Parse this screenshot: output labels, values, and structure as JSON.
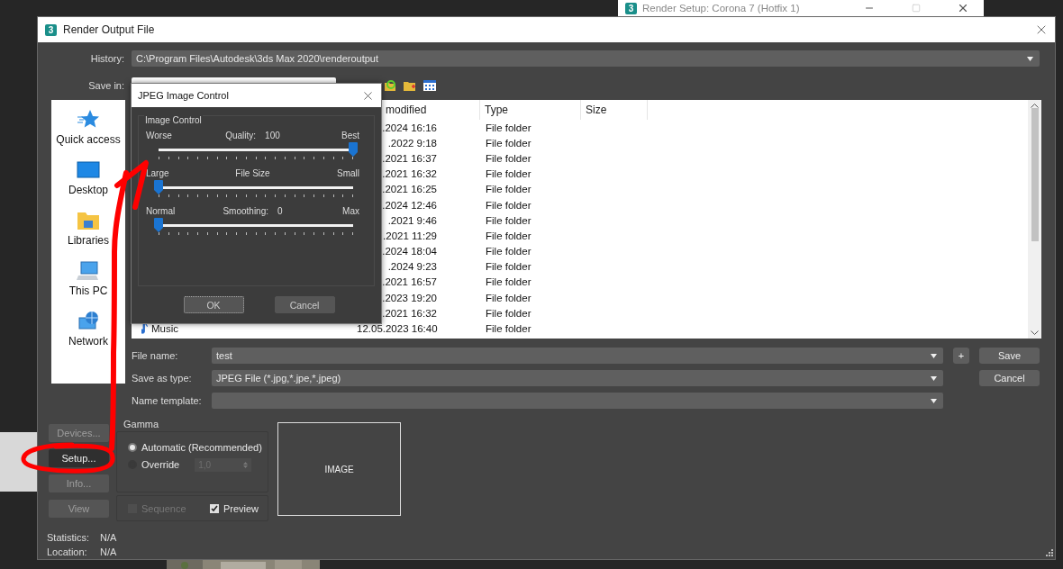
{
  "background_window": {
    "icon_text": "3",
    "title": "Render Setup: Corona 7 (Hotfix 1)"
  },
  "window": {
    "icon_text": "3",
    "title": "Render Output File"
  },
  "history": {
    "label": "History:",
    "value": "C:\\Program Files\\Autodesk\\3ds Max 2020\\renderoutput"
  },
  "save_in": {
    "label": "Save in:"
  },
  "places": [
    {
      "kind": "star",
      "label": "Quick access"
    },
    {
      "kind": "desktop",
      "label": "Desktop"
    },
    {
      "kind": "libraries",
      "label": "Libraries"
    },
    {
      "kind": "pc",
      "label": "This PC"
    },
    {
      "kind": "network",
      "label": "Network"
    }
  ],
  "file_list": {
    "columns": [
      {
        "label": "modified"
      },
      {
        "label": "Type"
      },
      {
        "label": "Size"
      }
    ],
    "rows": [
      {
        "date": ".2024 16:16",
        "type": "File folder"
      },
      {
        "date": ".2022 9:18",
        "type": "File folder"
      },
      {
        "date": ".2021 16:37",
        "type": "File folder"
      },
      {
        "date": ".2021 16:32",
        "type": "File folder"
      },
      {
        "date": ".2021 16:25",
        "type": "File folder"
      },
      {
        "date": ".2024 12:46",
        "type": "File folder"
      },
      {
        "date": ".2021 9:46",
        "type": "File folder"
      },
      {
        "date": ".2021 11:29",
        "type": "File folder"
      },
      {
        "date": ".2024 18:04",
        "type": "File folder"
      },
      {
        "date": ".2024 9:23",
        "type": "File folder"
      },
      {
        "date": ".2021 16:57",
        "type": "File folder"
      },
      {
        "date": ".2023 19:20",
        "type": "File folder"
      },
      {
        "date": ".2021 16:32",
        "type": "File folder"
      },
      {
        "name": "Music",
        "date": "12.05.2023 16:40",
        "type": "File folder"
      }
    ]
  },
  "file_name": {
    "label": "File name:",
    "value": "test"
  },
  "save_as_type": {
    "label": "Save as type:",
    "value": "JPEG File (*.jpg,*.jpe,*.jpeg)"
  },
  "name_template": {
    "label": "Name template:"
  },
  "add_button": "+",
  "dialog_buttons": [
    {
      "label": "Save"
    },
    {
      "label": "Cancel"
    }
  ],
  "side_buttons": [
    {
      "label": "Devices...",
      "disabled": true
    },
    {
      "label": "Setup...",
      "disabled": false
    },
    {
      "label": "Info...",
      "disabled": true
    },
    {
      "label": "View",
      "disabled": true
    }
  ],
  "gamma": {
    "title": "Gamma",
    "options": [
      {
        "label": "Automatic (Recommended)",
        "selected": true
      },
      {
        "label": "Override",
        "selected": false
      }
    ],
    "override": {
      "value": "1,0",
      "disabled": true
    }
  },
  "sequence": {
    "label": "Sequence",
    "checked": false,
    "disabled": true
  },
  "preview": {
    "label": "Preview",
    "checked": true,
    "disabled": false
  },
  "image_box": "IMAGE",
  "info": [
    {
      "label": "Statistics:",
      "value": "N/A"
    },
    {
      "label": "Location:",
      "value": "N/A"
    }
  ],
  "jpeg_dialog": {
    "title": "JPEG Image Control",
    "group": "Image Control",
    "sliders": [
      {
        "left": "Worse",
        "label": "Quality:",
        "reading": "100",
        "right": "Best",
        "level": 1
      },
      {
        "left": "Large",
        "label": "File Size",
        "right": "Small",
        "level": 0
      },
      {
        "left": "Normal",
        "label": "Smoothing:",
        "reading": "0",
        "right": "Max",
        "level": 0
      }
    ],
    "buttons": [
      {
        "label": "OK",
        "focused": true
      },
      {
        "label": "Cancel",
        "focused": false
      }
    ]
  }
}
